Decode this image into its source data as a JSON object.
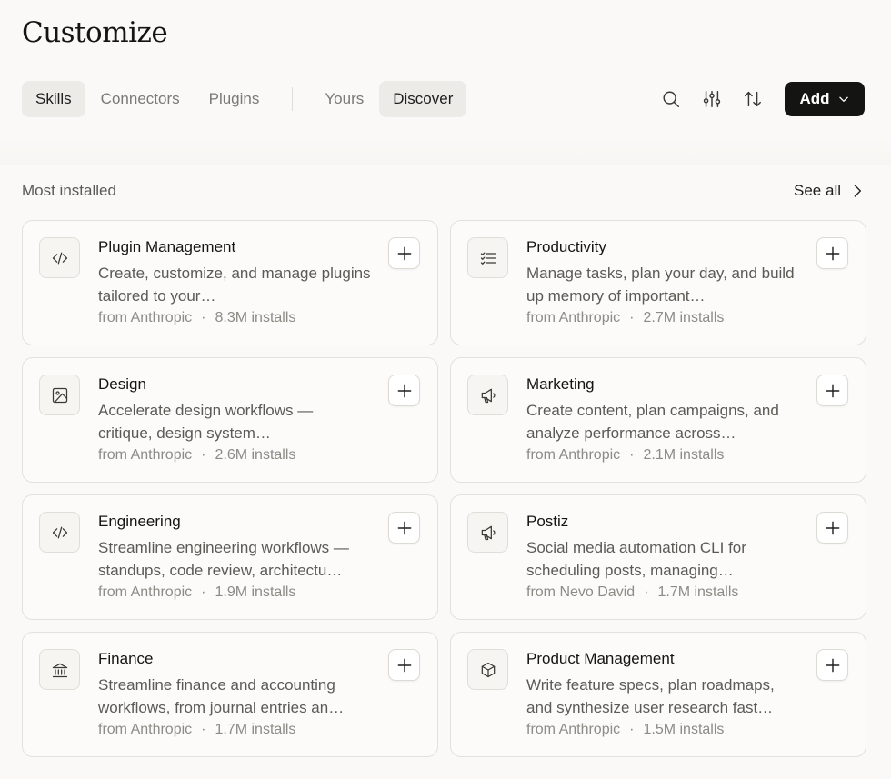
{
  "header": {
    "title": "Customize"
  },
  "tabs": {
    "primary": [
      {
        "label": "Skills",
        "active": true
      },
      {
        "label": "Connectors",
        "active": false
      },
      {
        "label": "Plugins",
        "active": false
      }
    ],
    "secondary": [
      {
        "label": "Yours",
        "active": false
      },
      {
        "label": "Discover",
        "active": true
      }
    ]
  },
  "toolbar": {
    "icons": [
      "search-icon",
      "filter-sliders-icon",
      "sort-arrows-icon"
    ],
    "add_label": "Add"
  },
  "section": {
    "label": "Most installed",
    "see_all_label": "See all"
  },
  "plugins": [
    {
      "name": "Plugin Management",
      "icon": "code-icon",
      "description": "Create, customize, and manage plugins tailored to your…",
      "author": "from Anthropic",
      "separator": "·",
      "installs": "8.3M installs"
    },
    {
      "name": "Productivity",
      "icon": "checklist-icon",
      "description": "Manage tasks, plan your day, and build up memory of important…",
      "author": "from Anthropic",
      "separator": "·",
      "installs": "2.7M installs"
    },
    {
      "name": "Design",
      "icon": "image-icon",
      "description": "Accelerate design workflows — critique, design system…",
      "author": "from Anthropic",
      "separator": "·",
      "installs": "2.6M installs"
    },
    {
      "name": "Marketing",
      "icon": "megaphone-icon",
      "description": "Create content, plan campaigns, and analyze performance across…",
      "author": "from Anthropic",
      "separator": "·",
      "installs": "2.1M installs"
    },
    {
      "name": "Engineering",
      "icon": "code-icon",
      "description": "Streamline engineering workflows — standups, code review, architectu…",
      "author": "from Anthropic",
      "separator": "·",
      "installs": "1.9M installs"
    },
    {
      "name": "Postiz",
      "icon": "megaphone-icon",
      "description": "Social media automation CLI for scheduling posts, managing…",
      "author": "from Nevo David",
      "separator": "·",
      "installs": "1.7M installs"
    },
    {
      "name": "Finance",
      "icon": "bank-icon",
      "description": "Streamline finance and accounting workflows, from journal entries an…",
      "author": "from Anthropic",
      "separator": "·",
      "installs": "1.7M installs"
    },
    {
      "name": "Product Management",
      "icon": "box-icon",
      "description": "Write feature specs, plan roadmaps, and synthesize user research fast…",
      "author": "from Anthropic",
      "separator": "·",
      "installs": "1.5M installs"
    }
  ]
}
